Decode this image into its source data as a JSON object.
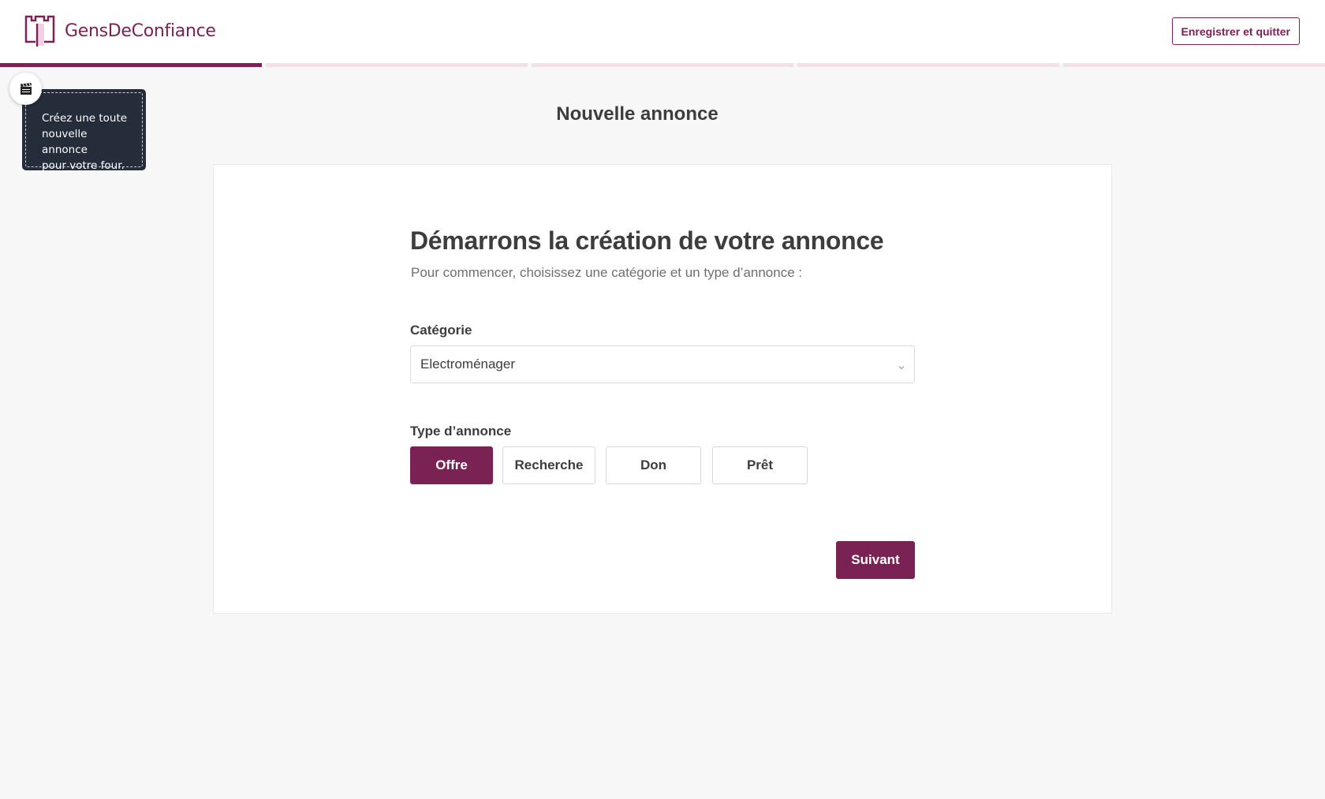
{
  "header": {
    "brand_name": "GensDeConfiance",
    "logo_icon": "castle-tower-icon",
    "save_quit_label": "Enregistrer et quitter",
    "accent_color": "#7b2255"
  },
  "progress": {
    "total_steps": 5,
    "current_step": 1
  },
  "tip": {
    "icon": "clapperboard-icon",
    "text_lines": [
      "Créez une toute",
      "nouvelle annonce",
      "pour votre four."
    ]
  },
  "page": {
    "title": "Nouvelle annonce"
  },
  "form": {
    "heading": "Démarrons la création de votre annonce",
    "subtitle": "Pour commencer, choisissez une catégorie et un type d’annonce :",
    "category_label": "Catégorie",
    "category_value": "Electroménager",
    "type_label": "Type d’annonce",
    "types": [
      "Offre",
      "Recherche",
      "Don",
      "Prêt"
    ],
    "selected_type": "Offre",
    "next_label": "Suivant"
  }
}
